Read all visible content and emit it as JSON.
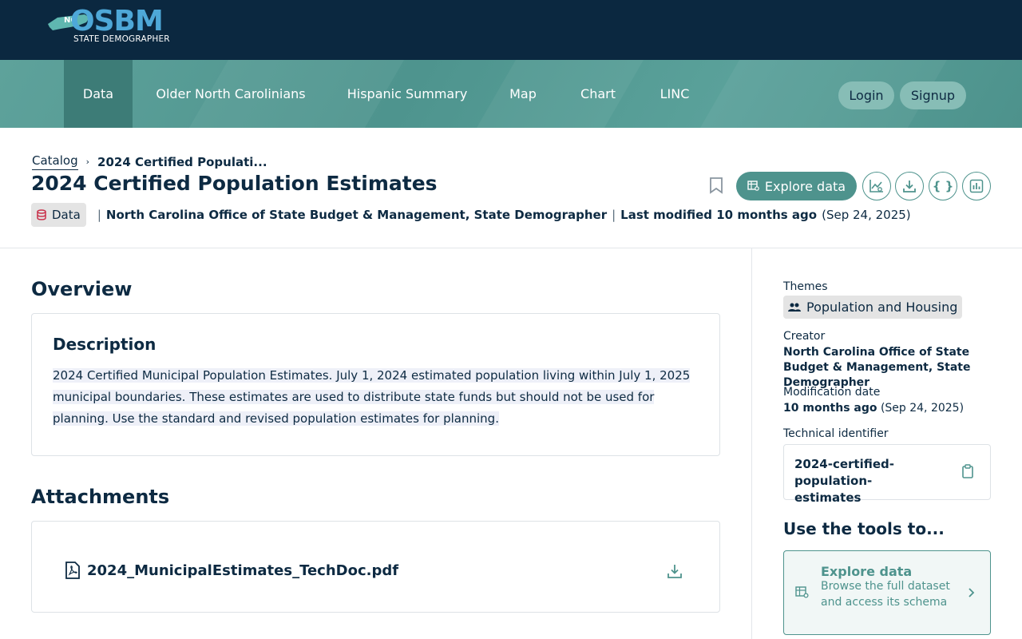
{
  "header": {
    "logo": {
      "brand": "OSBM",
      "state_tag": "NC",
      "subtitle": "STATE DEMOGRAPHER"
    },
    "nav": [
      "Data",
      "Older North Carolinians",
      "Hispanic Summary",
      "Map",
      "Chart",
      "LINC"
    ],
    "login_label": "Login",
    "signup_label": "Signup"
  },
  "breadcrumb": {
    "root": "Catalog",
    "current": "2024 Certified Populati..."
  },
  "dataset": {
    "title": "2024 Certified Population Estimates",
    "type": "Data",
    "publisher": "North Carolina Office of State Budget & Management, State Demographer",
    "last_modified_label": "Last modified 10 months ago",
    "last_modified_date": "(Sep 24, 2025)"
  },
  "actions": {
    "explore_label": "Explore data",
    "icons": [
      "bookmark-icon",
      "chart-line-icon",
      "download-icon",
      "api-braces-icon",
      "chart-bar-icon"
    ]
  },
  "overview": {
    "title": "Overview",
    "description_title": "Description",
    "description": "2024 Certified Municipal Population Estimates.  July 1, 2024 estimated population living within July 1, 2025 municipal boundaries. These estimates are used to distribute state funds but should not be used for planning.  Use the standard and revised population estimates for planning. "
  },
  "attachments": {
    "title": "Attachments",
    "files": [
      {
        "name": "2024_MunicipalEstimates_TechDoc.pdf"
      }
    ]
  },
  "sidebar": {
    "themes_label": "Themes",
    "theme": "Population and Housing",
    "creator_label": "Creator",
    "creator": "North Carolina Office of State Budget & Management, State Demographer",
    "modification_label": "Modification date",
    "modification_relative": "10 months ago",
    "modification_date": "(Sep 24, 2025)",
    "identifier_label": "Technical identifier",
    "identifier": "2024-certified-population-estimates",
    "tools_title": "Use the tools to...",
    "tool": {
      "name": "Explore data",
      "description": "Browse the full dataset and access its schema"
    }
  },
  "colors": {
    "header_bg": "#0b2840",
    "nav_bg": "#4e948e",
    "accent": "#4e938d",
    "text": "#0d2a42"
  }
}
